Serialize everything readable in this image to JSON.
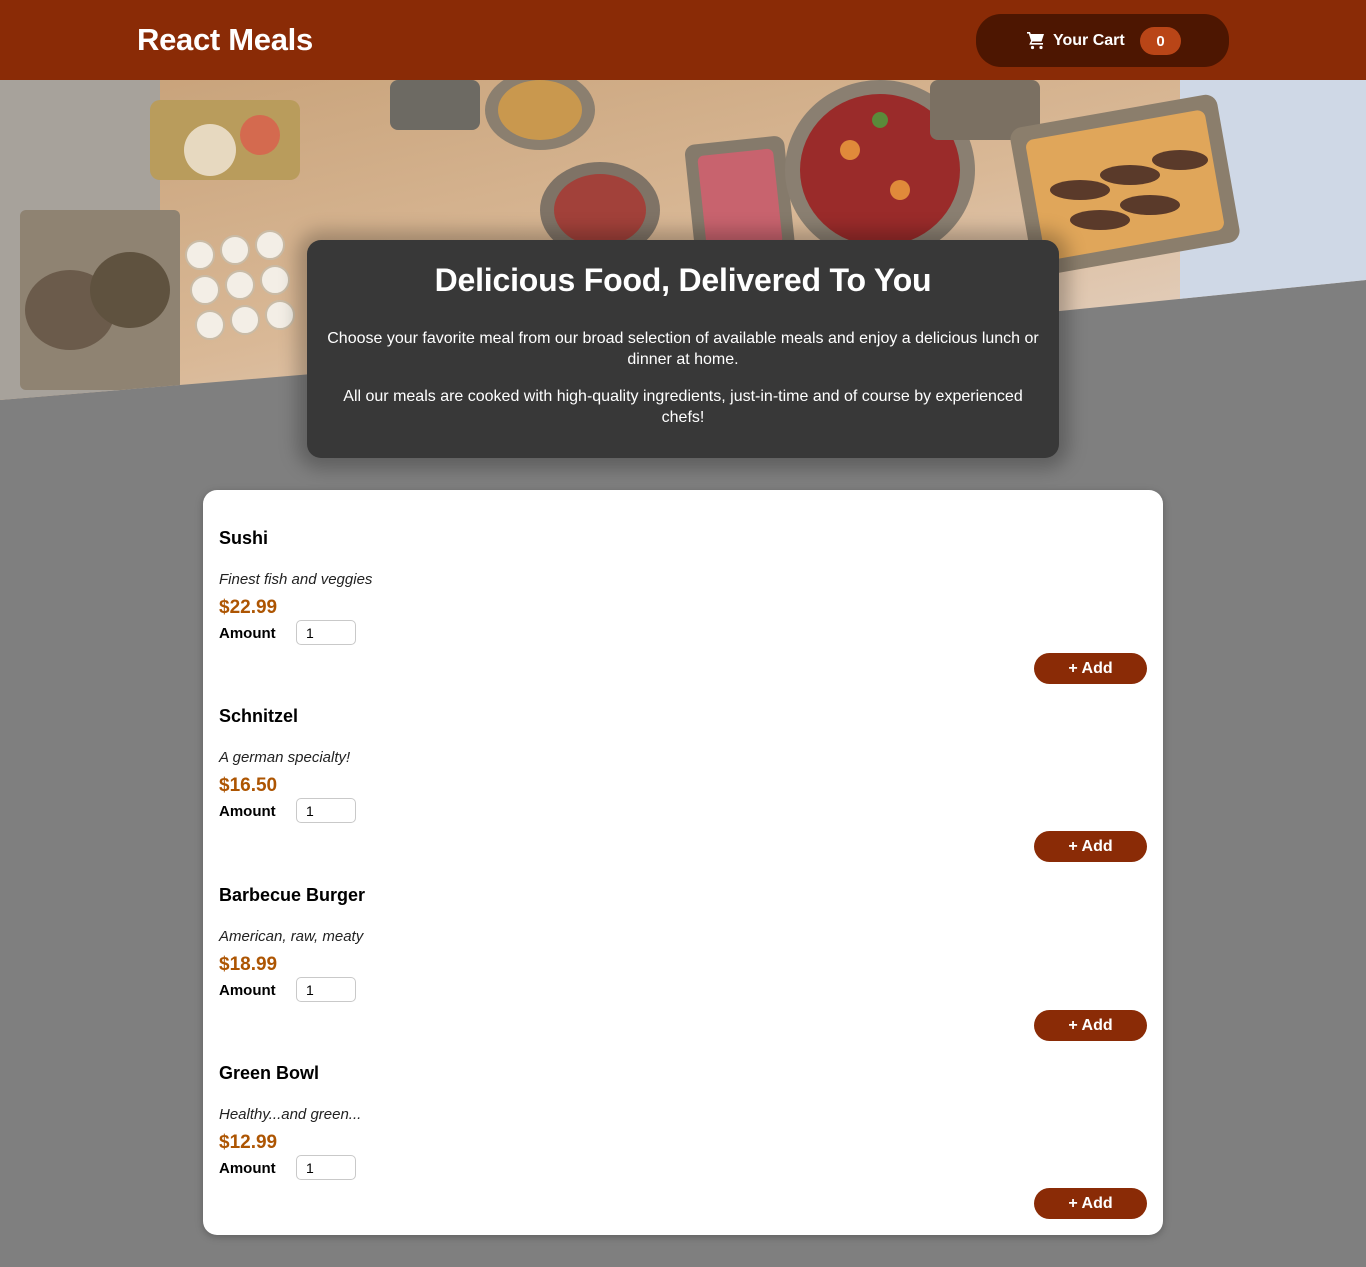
{
  "header": {
    "title": "React Meals",
    "cart": {
      "label": "Your Cart",
      "count": "0",
      "icon": "cart-icon"
    }
  },
  "summary": {
    "heading": "Delicious Food, Delivered To You",
    "paragraph1": "Choose your favorite meal from our broad selection of available meals and enjoy a delicious lunch or dinner at home.",
    "paragraph2": "All our meals are cooked with high-quality ingredients, just-in-time and of course by experienced chefs!"
  },
  "meals": [
    {
      "name": "Sushi",
      "description": "Finest fish and veggies",
      "price": "$22.99",
      "amount_label": "Amount",
      "amount_value": "1",
      "add_label": "+ Add"
    },
    {
      "name": "Schnitzel",
      "description": "A german specialty!",
      "price": "$16.50",
      "amount_label": "Amount",
      "amount_value": "1",
      "add_label": "+ Add"
    },
    {
      "name": "Barbecue Burger",
      "description": "American, raw, meaty",
      "price": "$18.99",
      "amount_label": "Amount",
      "amount_value": "1",
      "add_label": "+ Add"
    },
    {
      "name": "Green Bowl",
      "description": "Healthy...and green...",
      "price": "$12.99",
      "amount_label": "Amount",
      "amount_value": "1",
      "add_label": "+ Add"
    }
  ],
  "colors": {
    "header": "#8a2b06",
    "cart_button": "#4d1601",
    "cart_badge": "#b94517",
    "price": "#ad5502",
    "page_background": "#7f7f7f",
    "summary_background": "#383838"
  }
}
